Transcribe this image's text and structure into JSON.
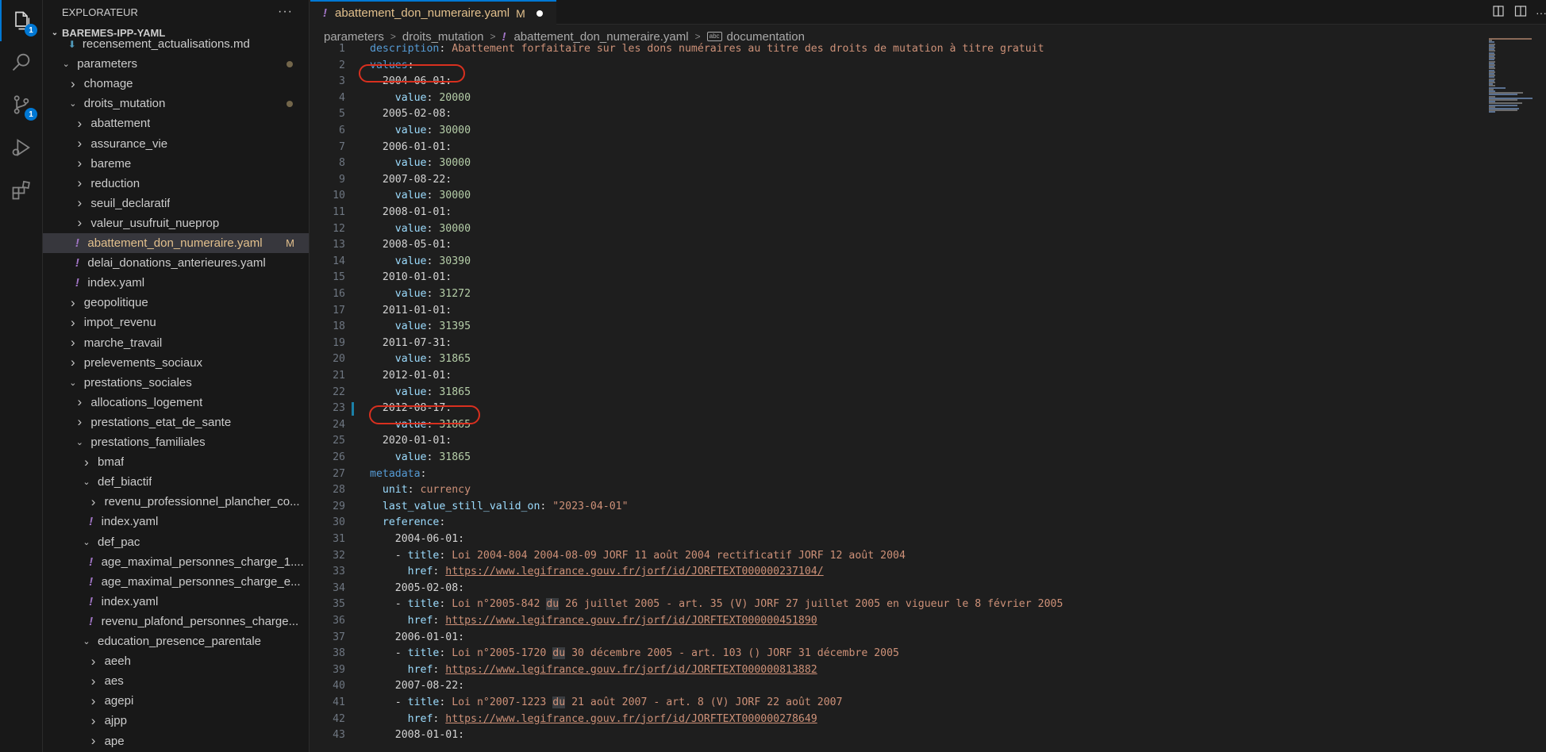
{
  "activity_bar": {
    "explorer_badge": "1",
    "scm_badge": "1"
  },
  "sidebar": {
    "title": "EXPLORATEUR",
    "more_actions": "···",
    "section": "BAREMES-IPP-YAML",
    "items": [
      {
        "label": "recensement_actualisations.md",
        "type": "md"
      },
      {
        "label": "parameters",
        "type": "folder-open",
        "modified": true
      },
      {
        "label": "chomage",
        "type": "folder"
      },
      {
        "label": "droits_mutation",
        "type": "folder-open",
        "modified": true
      },
      {
        "label": "abattement",
        "type": "folder"
      },
      {
        "label": "assurance_vie",
        "type": "folder"
      },
      {
        "label": "bareme",
        "type": "folder"
      },
      {
        "label": "reduction",
        "type": "folder"
      },
      {
        "label": "seuil_declaratif",
        "type": "folder"
      },
      {
        "label": "valeur_usufruit_nueprop",
        "type": "folder"
      },
      {
        "label": "abattement_don_numeraire.yaml",
        "type": "yaml",
        "badge": "M",
        "selected": true
      },
      {
        "label": "delai_donations_anterieures.yaml",
        "type": "yaml"
      },
      {
        "label": "index.yaml",
        "type": "yaml"
      },
      {
        "label": "geopolitique",
        "type": "folder"
      },
      {
        "label": "impot_revenu",
        "type": "folder"
      },
      {
        "label": "marche_travail",
        "type": "folder"
      },
      {
        "label": "prelevements_sociaux",
        "type": "folder"
      },
      {
        "label": "prestations_sociales",
        "type": "folder-open"
      },
      {
        "label": "allocations_logement",
        "type": "folder"
      },
      {
        "label": "prestations_etat_de_sante",
        "type": "folder"
      },
      {
        "label": "prestations_familiales",
        "type": "folder-open"
      },
      {
        "label": "bmaf",
        "type": "folder"
      },
      {
        "label": "def_biactif",
        "type": "folder-open"
      },
      {
        "label": "revenu_professionnel_plancher_co...",
        "type": "folder"
      },
      {
        "label": "index.yaml",
        "type": "yaml"
      },
      {
        "label": "def_pac",
        "type": "folder-open"
      },
      {
        "label": "age_maximal_personnes_charge_1....",
        "type": "yaml"
      },
      {
        "label": "age_maximal_personnes_charge_e...",
        "type": "yaml"
      },
      {
        "label": "index.yaml",
        "type": "yaml"
      },
      {
        "label": "revenu_plafond_personnes_charge...",
        "type": "yaml"
      },
      {
        "label": "education_presence_parentale",
        "type": "folder-open"
      },
      {
        "label": "aeeh",
        "type": "folder"
      },
      {
        "label": "aes",
        "type": "folder"
      },
      {
        "label": "agepi",
        "type": "folder"
      },
      {
        "label": "ajpp",
        "type": "folder"
      },
      {
        "label": "ape",
        "type": "folder"
      }
    ]
  },
  "tab": {
    "label": "abattement_don_numeraire.yaml",
    "status": "M",
    "yaml_icon": "!"
  },
  "breadcrumb": {
    "items": [
      "parameters",
      "droits_mutation",
      "abattement_don_numeraire.yaml",
      "documentation"
    ]
  },
  "editor": {
    "lines": [
      {
        "n": "1",
        "parts": [
          [
            "k1",
            "description"
          ],
          [
            "punct",
            ": "
          ],
          [
            "str",
            "Abattement forfaitaire sur les dons numéraires au titre des droits de mutation à titre gratuit"
          ]
        ]
      },
      {
        "n": "2",
        "parts": [
          [
            "k1",
            "values"
          ],
          [
            "punct",
            ":"
          ]
        ]
      },
      {
        "n": "3",
        "parts": [
          [
            "punct",
            "  2004-06-01:"
          ]
        ]
      },
      {
        "n": "4",
        "parts": [
          [
            "punct",
            "    "
          ],
          [
            "k2",
            "value"
          ],
          [
            "punct",
            ": "
          ],
          [
            "num",
            "20000"
          ]
        ]
      },
      {
        "n": "5",
        "parts": [
          [
            "punct",
            "  2005-02-08:"
          ]
        ]
      },
      {
        "n": "6",
        "parts": [
          [
            "punct",
            "    "
          ],
          [
            "k2",
            "value"
          ],
          [
            "punct",
            ": "
          ],
          [
            "num",
            "30000"
          ]
        ]
      },
      {
        "n": "7",
        "parts": [
          [
            "punct",
            "  2006-01-01:"
          ]
        ]
      },
      {
        "n": "8",
        "parts": [
          [
            "punct",
            "    "
          ],
          [
            "k2",
            "value"
          ],
          [
            "punct",
            ": "
          ],
          [
            "num",
            "30000"
          ]
        ]
      },
      {
        "n": "9",
        "parts": [
          [
            "punct",
            "  2007-08-22:"
          ]
        ]
      },
      {
        "n": "10",
        "parts": [
          [
            "punct",
            "    "
          ],
          [
            "k2",
            "value"
          ],
          [
            "punct",
            ": "
          ],
          [
            "num",
            "30000"
          ]
        ]
      },
      {
        "n": "11",
        "parts": [
          [
            "punct",
            "  2008-01-01:"
          ]
        ]
      },
      {
        "n": "12",
        "parts": [
          [
            "punct",
            "    "
          ],
          [
            "k2",
            "value"
          ],
          [
            "punct",
            ": "
          ],
          [
            "num",
            "30000"
          ]
        ]
      },
      {
        "n": "13",
        "parts": [
          [
            "punct",
            "  2008-05-01:"
          ]
        ]
      },
      {
        "n": "14",
        "parts": [
          [
            "punct",
            "    "
          ],
          [
            "k2",
            "value"
          ],
          [
            "punct",
            ": "
          ],
          [
            "num",
            "30390"
          ]
        ]
      },
      {
        "n": "15",
        "parts": [
          [
            "punct",
            "  2010-01-01:"
          ]
        ]
      },
      {
        "n": "16",
        "parts": [
          [
            "punct",
            "    "
          ],
          [
            "k2",
            "value"
          ],
          [
            "punct",
            ": "
          ],
          [
            "num",
            "31272"
          ]
        ]
      },
      {
        "n": "17",
        "parts": [
          [
            "punct",
            "  2011-01-01:"
          ]
        ]
      },
      {
        "n": "18",
        "parts": [
          [
            "punct",
            "    "
          ],
          [
            "k2",
            "value"
          ],
          [
            "punct",
            ": "
          ],
          [
            "num",
            "31395"
          ]
        ]
      },
      {
        "n": "19",
        "parts": [
          [
            "punct",
            "  2011-07-31:"
          ]
        ]
      },
      {
        "n": "20",
        "parts": [
          [
            "punct",
            "    "
          ],
          [
            "k2",
            "value"
          ],
          [
            "punct",
            ": "
          ],
          [
            "num",
            "31865"
          ]
        ]
      },
      {
        "n": "21",
        "parts": [
          [
            "punct",
            "  2012-01-01:"
          ]
        ]
      },
      {
        "n": "22",
        "parts": [
          [
            "punct",
            "    "
          ],
          [
            "k2",
            "value"
          ],
          [
            "punct",
            ": "
          ],
          [
            "num",
            "31865"
          ]
        ]
      },
      {
        "n": "23",
        "parts": [
          [
            "punct",
            "  2012-08-17:"
          ]
        ]
      },
      {
        "n": "24",
        "parts": [
          [
            "punct",
            "    "
          ],
          [
            "k2",
            "value"
          ],
          [
            "punct",
            ": "
          ],
          [
            "num",
            "31865"
          ]
        ]
      },
      {
        "n": "25",
        "parts": [
          [
            "punct",
            "  2020-01-01:"
          ]
        ]
      },
      {
        "n": "26",
        "parts": [
          [
            "punct",
            "    "
          ],
          [
            "k2",
            "value"
          ],
          [
            "punct",
            ": "
          ],
          [
            "num",
            "31865"
          ]
        ]
      },
      {
        "n": "27",
        "parts": [
          [
            "k1",
            "metadata"
          ],
          [
            "punct",
            ":"
          ]
        ]
      },
      {
        "n": "28",
        "parts": [
          [
            "punct",
            "  "
          ],
          [
            "k2",
            "unit"
          ],
          [
            "punct",
            ": "
          ],
          [
            "str",
            "currency"
          ]
        ]
      },
      {
        "n": "29",
        "parts": [
          [
            "punct",
            "  "
          ],
          [
            "k2",
            "last_value_still_valid_on"
          ],
          [
            "punct",
            ": "
          ],
          [
            "str",
            "\"2023-04-01\""
          ]
        ]
      },
      {
        "n": "30",
        "parts": [
          [
            "punct",
            "  "
          ],
          [
            "k2",
            "reference"
          ],
          [
            "punct",
            ":"
          ]
        ]
      },
      {
        "n": "31",
        "parts": [
          [
            "punct",
            "    2004-06-01:"
          ]
        ]
      },
      {
        "n": "32",
        "parts": [
          [
            "punct",
            "    - "
          ],
          [
            "k2",
            "title"
          ],
          [
            "punct",
            ": "
          ],
          [
            "str",
            "Loi 2004-804 2004-08-09 JORF 11 août 2004 rectificatif JORF 12 août 2004"
          ]
        ]
      },
      {
        "n": "33",
        "parts": [
          [
            "punct",
            "      "
          ],
          [
            "k2",
            "href"
          ],
          [
            "punct",
            ": "
          ],
          [
            "link",
            "https://www.legifrance.gouv.fr/jorf/id/JORFTEXT000000237104/"
          ]
        ]
      },
      {
        "n": "34",
        "parts": [
          [
            "punct",
            "    2005-02-08:"
          ]
        ]
      },
      {
        "n": "35",
        "parts": [
          [
            "punct",
            "    - "
          ],
          [
            "k2",
            "title"
          ],
          [
            "punct",
            ": "
          ],
          [
            "str",
            "Loi n°2005-842 "
          ],
          [
            "hlstr",
            "du"
          ],
          [
            "str",
            " 26 juillet 2005 - art. 35 (V) JORF 27 juillet 2005 en vigueur le 8 février 2005"
          ]
        ]
      },
      {
        "n": "36",
        "parts": [
          [
            "punct",
            "      "
          ],
          [
            "k2",
            "href"
          ],
          [
            "punct",
            ": "
          ],
          [
            "link",
            "https://www.legifrance.gouv.fr/jorf/id/JORFTEXT000000451890"
          ]
        ]
      },
      {
        "n": "37",
        "parts": [
          [
            "punct",
            "    2006-01-01:"
          ]
        ]
      },
      {
        "n": "38",
        "parts": [
          [
            "punct",
            "    - "
          ],
          [
            "k2",
            "title"
          ],
          [
            "punct",
            ": "
          ],
          [
            "str",
            "Loi n°2005-1720 "
          ],
          [
            "hlstr",
            "du"
          ],
          [
            "str",
            " 30 décembre 2005 - art. 103 () JORF 31 décembre 2005"
          ]
        ]
      },
      {
        "n": "39",
        "parts": [
          [
            "punct",
            "      "
          ],
          [
            "k2",
            "href"
          ],
          [
            "punct",
            ": "
          ],
          [
            "link",
            "https://www.legifrance.gouv.fr/jorf/id/JORFTEXT000000813882"
          ]
        ]
      },
      {
        "n": "40",
        "parts": [
          [
            "punct",
            "    2007-08-22:"
          ]
        ]
      },
      {
        "n": "41",
        "parts": [
          [
            "punct",
            "    - "
          ],
          [
            "k2",
            "title"
          ],
          [
            "punct",
            ": "
          ],
          [
            "str",
            "Loi n°2007-1223 "
          ],
          [
            "hlstr",
            "du"
          ],
          [
            "str",
            " 21 août 2007 - art. 8 (V) JORF 22 août 2007"
          ]
        ]
      },
      {
        "n": "42",
        "parts": [
          [
            "punct",
            "      "
          ],
          [
            "k2",
            "href"
          ],
          [
            "punct",
            ": "
          ],
          [
            "link",
            "https://www.legifrance.gouv.fr/jorf/id/JORFTEXT000000278649"
          ]
        ]
      },
      {
        "n": "43",
        "parts": [
          [
            "punct",
            "    2008-01-01:"
          ]
        ]
      }
    ]
  },
  "colors": {
    "accent": "#0078d4",
    "annotation_ring": "#d9301f",
    "modified": "#e2c08d"
  }
}
